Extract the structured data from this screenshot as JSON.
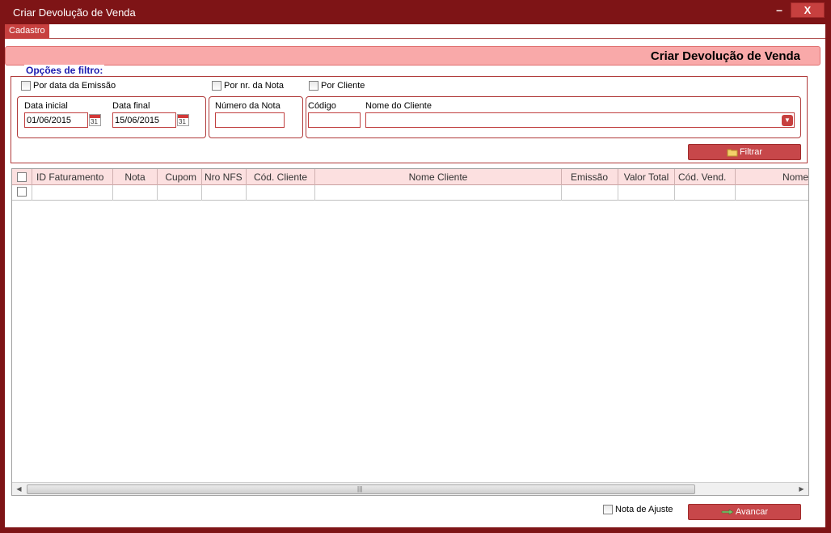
{
  "window": {
    "title": "Criar Devolução de Venda",
    "minimize": "–",
    "close": "X"
  },
  "menu": {
    "items": [
      {
        "label": "Cadastro"
      }
    ]
  },
  "header": {
    "title": "Criar Devolução de Venda"
  },
  "filter": {
    "legend": "Opções de filtro:",
    "by_date_label": "Por data da Emissão",
    "by_note_label": "Por nr. da Nota",
    "by_client_label": "Por Cliente",
    "start_date_label": "Data inicial",
    "start_date_value": "01/06/2015",
    "end_date_label": "Data final",
    "end_date_value": "15/06/2015",
    "calendar_day": "31",
    "note_number_label": "Número da Nota",
    "note_number_value": "",
    "code_label": "Código",
    "code_value": "",
    "client_name_label": "Nome do Cliente",
    "client_name_value": "",
    "filter_button": "Filtrar"
  },
  "grid": {
    "columns": [
      "ID Faturamento",
      "Nota",
      "Cupom",
      "Nro NFS",
      "Cód. Cliente",
      "Nome Cliente",
      "Emissão",
      "Valor Total",
      "Cód. Vend.",
      "Nome"
    ],
    "rows": []
  },
  "footer": {
    "adjust_note_label": "Nota de Ajuste",
    "next_button": "Avancar"
  },
  "colors": {
    "frame": "#7e1416",
    "accent": "#c7403f",
    "header_bg": "#f9a9a9",
    "legend": "#1c1cb0"
  }
}
